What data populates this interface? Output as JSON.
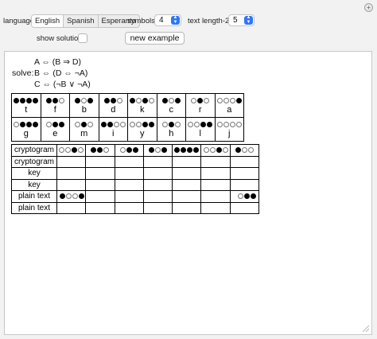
{
  "controls": {
    "language_label": "language",
    "languages": [
      "English",
      "Spanish",
      "Esperanto"
    ],
    "language_selected": "English",
    "symbols_label": "symbols",
    "symbols_value": "4",
    "text_length_label": "text length-2",
    "text_length_value": "5",
    "show_solution_label": "show solution",
    "show_solution_checked": false,
    "new_example_label": "new example",
    "pin_glyph": "+"
  },
  "equations": {
    "line1": "A ⇔ (B ⇒ D)",
    "solve_label": "solve:",
    "line2": "B ⇔ (D ⇔ ¬A)",
    "line3": "C ⇔ (¬B ∨ ¬A)"
  },
  "cipher_table": {
    "row1": [
      {
        "letter": "t",
        "pattern": "bbbb"
      },
      {
        "letter": "f",
        "pattern": "bbw"
      },
      {
        "letter": "b",
        "pattern": "bwb"
      },
      {
        "letter": "d",
        "pattern": "bbw"
      },
      {
        "letter": "k",
        "pattern": "bwbw"
      },
      {
        "letter": "c",
        "pattern": "bwb"
      },
      {
        "letter": "r",
        "pattern": "wbw"
      },
      {
        "letter": "a",
        "pattern": "wwwb"
      }
    ],
    "row2": [
      {
        "letter": "g",
        "pattern": "wbbb"
      },
      {
        "letter": "e",
        "pattern": "wbb"
      },
      {
        "letter": "m",
        "pattern": "wbw"
      },
      {
        "letter": "i",
        "pattern": "bbww"
      },
      {
        "letter": "y",
        "pattern": "wwbb"
      },
      {
        "letter": "h",
        "pattern": "wbw"
      },
      {
        "letter": "l",
        "pattern": "wwbb"
      },
      {
        "letter": "j",
        "pattern": "wwww"
      }
    ]
  },
  "grid": {
    "row_labels": [
      "cryptogram",
      "cryptogram",
      "key",
      "key",
      "plain text",
      "plain text"
    ],
    "cryptogram_patterns": [
      "wwbw",
      "bbw",
      "wbb",
      "bwb",
      "bbbb",
      "wwbw",
      "bww"
    ],
    "plain_text_first": "bwwb",
    "plain_text_last": "wbb"
  },
  "colors": {
    "accent": "#2f76f6",
    "panel_bg": "#ffffff",
    "window_bg": "#f2f2f2"
  }
}
